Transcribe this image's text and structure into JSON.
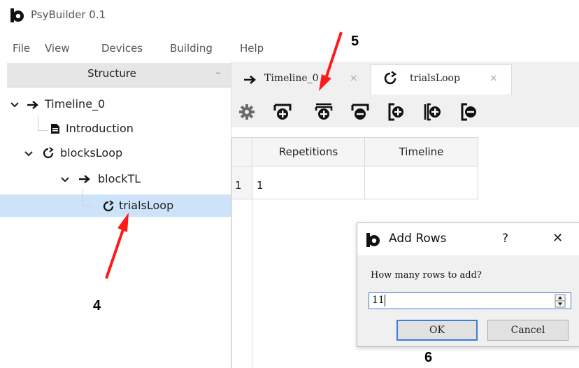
{
  "app": {
    "title": "PsyBuilder 0.1",
    "logo_icon": "psybuilder-logo"
  },
  "menu": [
    "File",
    "View",
    "Devices",
    "Building",
    "Help"
  ],
  "structure": {
    "title": "Structure",
    "minimize": "–",
    "tree": [
      {
        "label": "Timeline_0",
        "icon": "arrow-right-icon"
      },
      {
        "label": "Introduction",
        "icon": "document-icon"
      },
      {
        "label": "blocksLoop",
        "icon": "loop-icon"
      },
      {
        "label": "blockTL",
        "icon": "arrow-right-icon"
      },
      {
        "label": "trialsLoop",
        "icon": "loop-icon",
        "selected": true
      }
    ]
  },
  "tabs": [
    {
      "label": "Timeline_0",
      "close": "×"
    },
    {
      "label": "trialsLoop",
      "close": "×"
    }
  ],
  "table": {
    "headers": [
      "Repetitions",
      "Timeline"
    ],
    "rows": [
      {
        "index": "1",
        "cells": [
          "1",
          ""
        ]
      }
    ]
  },
  "dialog": {
    "title": "Add Rows",
    "help": "?",
    "close": "✕",
    "prompt": "How many rows to add?",
    "value": "11",
    "ok": "OK",
    "cancel": "Cancel"
  },
  "annotations": [
    "4",
    "5",
    "6"
  ],
  "colors": {
    "selection": "#cde3fa",
    "arrow": "#ff1a1a",
    "focus": "#3b7dd8"
  }
}
